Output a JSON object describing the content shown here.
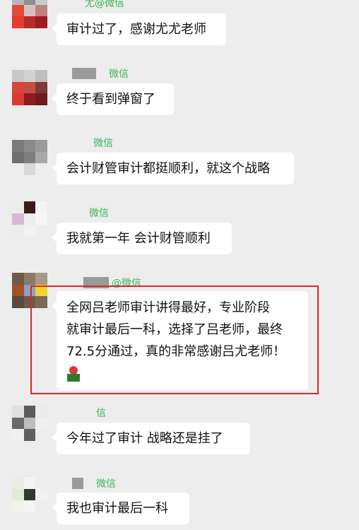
{
  "messages": [
    {
      "name": "尤@微信",
      "text": "审计过了，感谢尤尤老师"
    },
    {
      "name": "微信",
      "text": "终于看到弹窗了"
    },
    {
      "name": "微信",
      "text": "会计财管审计都挺顺利，就这个战略"
    },
    {
      "name": "微信",
      "text": "我就第一年 会计财管顺利"
    },
    {
      "name": "@微信",
      "lines": [
        "全网吕老师审计讲得最好，专业阶段",
        "就审计最后一科，选择了吕老师，最终",
        "72.5分通过，真的非常感谢吕尤老师！"
      ],
      "emoji": "rose-icon"
    },
    {
      "name": "信",
      "text": "今年过了审计  战略还是挂了"
    },
    {
      "name": "微信",
      "text": "我也审计最后一科"
    }
  ],
  "colors": {
    "background": "#ededed",
    "bubble": "#ffffff",
    "name": "#3cb35a",
    "highlight": "#e0252b"
  }
}
